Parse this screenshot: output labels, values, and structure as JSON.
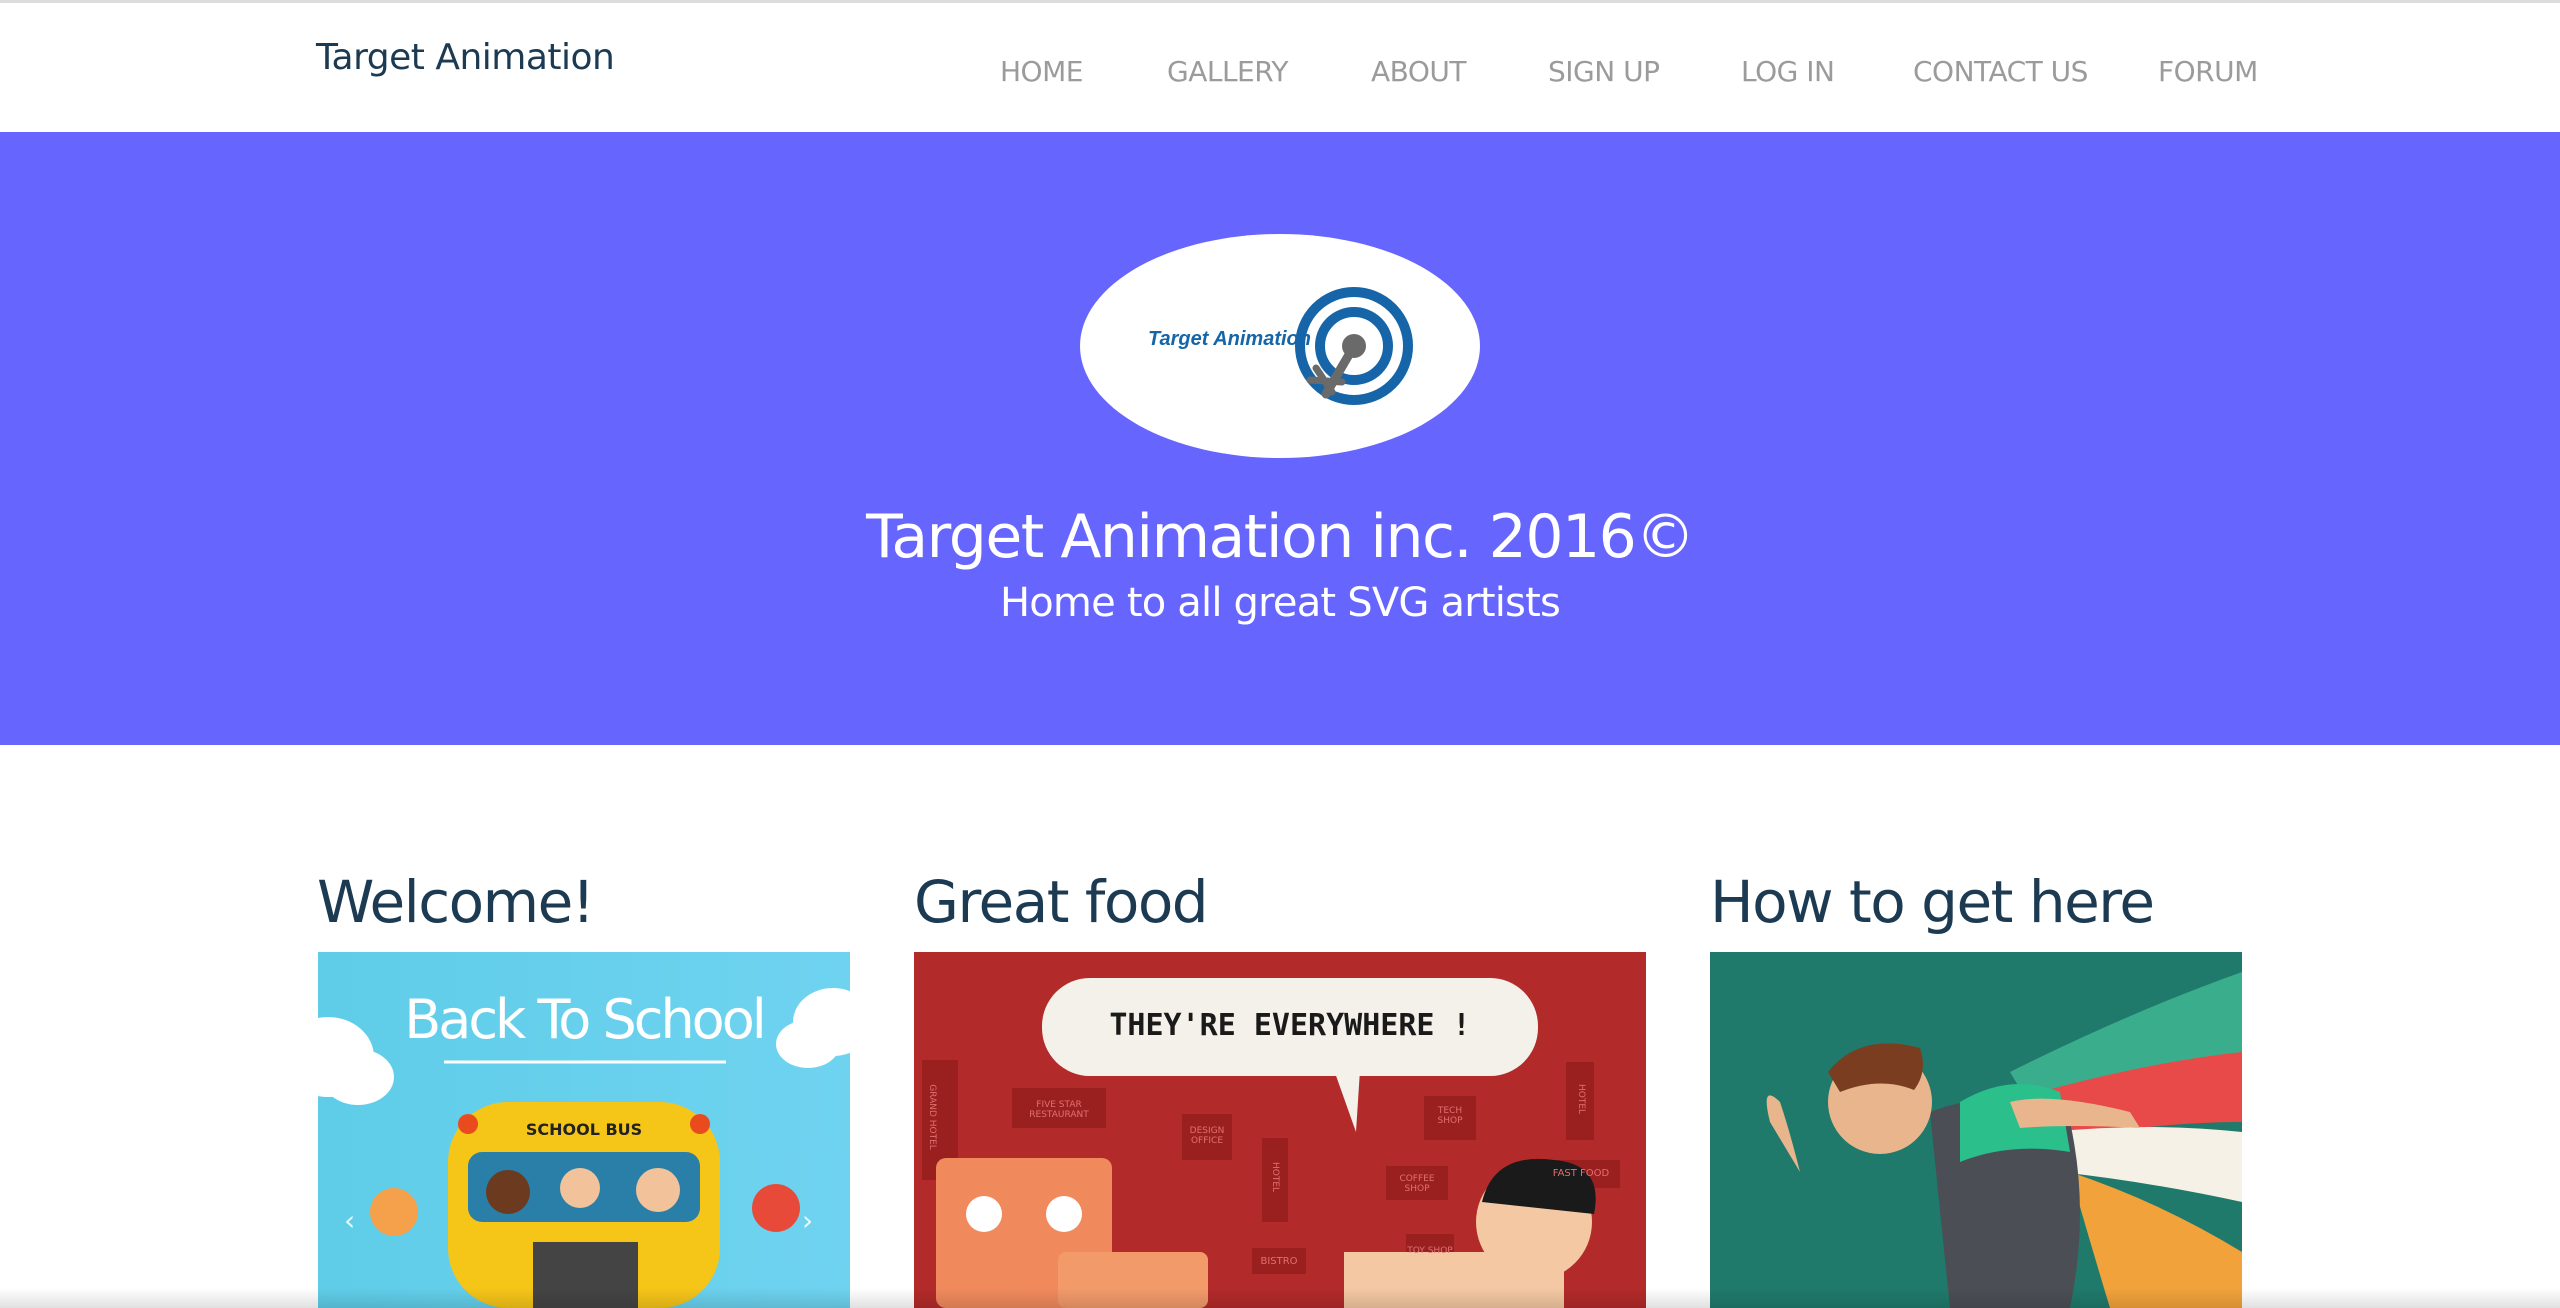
{
  "navbar": {
    "brand": "Target Animation",
    "items": [
      {
        "label": "HOME"
      },
      {
        "label": "GALLERY"
      },
      {
        "label": "ABOUT"
      },
      {
        "label": "SIGN UP"
      },
      {
        "label": "LOG IN"
      },
      {
        "label": "CONTACT US"
      },
      {
        "label": "FORUM"
      }
    ]
  },
  "hero": {
    "logo_text": "Target Animation",
    "title": "Target Animation inc. 2016©",
    "subtitle": "Home to all great SVG artists",
    "background_color": "#6666ff"
  },
  "cards": [
    {
      "title": "Welcome!",
      "image": {
        "banner": "Back To School",
        "bus_label": "SCHOOL BUS",
        "prev_icon": "chevron-left-icon",
        "next_icon": "chevron-right-icon"
      }
    },
    {
      "title": "Great food",
      "image": {
        "speech": "THEY'RE EVERYWHERE !",
        "signs": [
          "GRAND HOTEL",
          "FIVE STAR RESTAURANT",
          "DESIGN OFFICE",
          "HOTEL",
          "TECH SHOP",
          "COFFEE SHOP",
          "HOTEL",
          "FAST FOOD",
          "TOY SHOP",
          "BISTRO"
        ]
      }
    },
    {
      "title": "How to get here",
      "image": {}
    }
  ],
  "colors": {
    "brand_text": "#1c3a52",
    "nav_text": "#9b9b9b",
    "hero_bg": "#6666ff",
    "logo_blue": "#1565a8"
  }
}
